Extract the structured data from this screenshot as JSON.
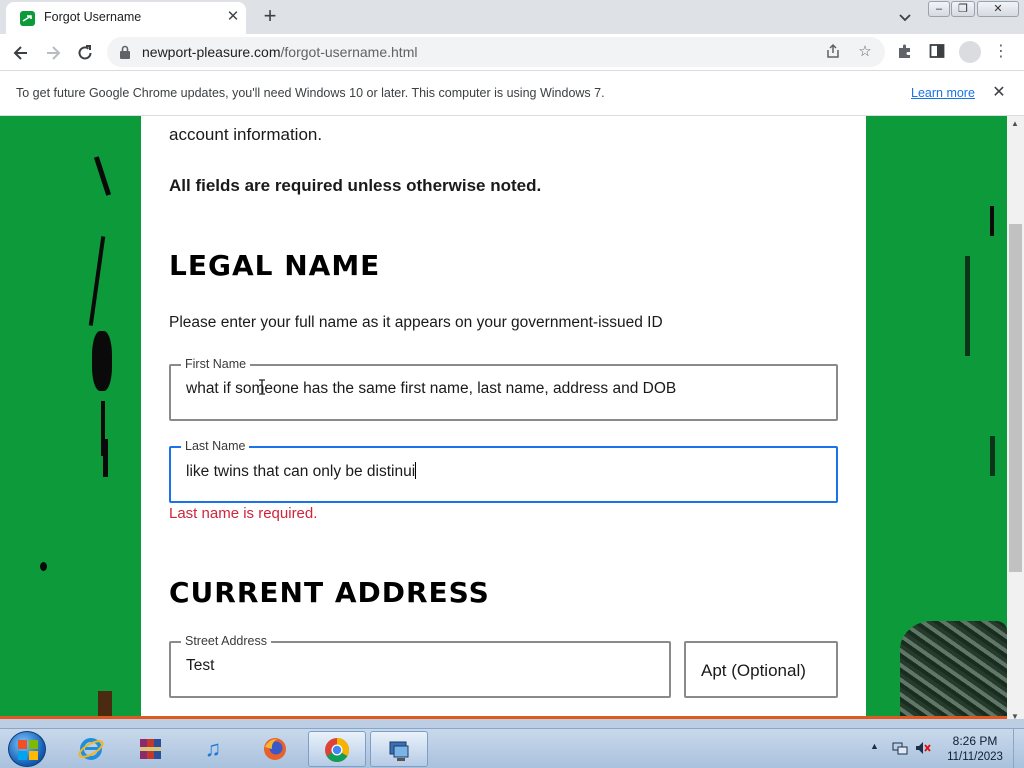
{
  "browser": {
    "tab_title": "Forgot Username",
    "tab_close": "✕",
    "new_tab": "+",
    "url_host": "newport-pleasure.com",
    "url_path": "/forgot-username.html",
    "infobar_text": "To get future Google Chrome updates, you'll need Windows 10 or later. This computer is using Windows 7.",
    "infobar_link": "Learn more",
    "infobar_close": "✕"
  },
  "page": {
    "intro_tail": "account information.",
    "required_note": "All fields are required unless otherwise noted.",
    "legal_name_title": "LEGAL NAME",
    "legal_name_helper": "Please enter your full name as it appears on your government-issued ID",
    "first_name_label": "First Name",
    "first_name_value": "what if someone has the same first name, last name, address and DOB",
    "last_name_label": "Last Name",
    "last_name_value": "like twins that can only be distinui",
    "last_name_error": "Last name is required.",
    "current_address_title": "CURRENT ADDRESS",
    "street_label": "Street Address",
    "street_value": "Test",
    "apt_placeholder": "Apt (Optional)"
  },
  "taskbar": {
    "apps": [
      "internet-explorer",
      "archive-manager",
      "itunes",
      "firefox",
      "chrome",
      "remote-desktop"
    ],
    "active_app": "chrome",
    "time": "8:26 PM",
    "date": "11/11/2023"
  },
  "colors": {
    "page_background": "#0d9a3a",
    "focus_border": "#1a73e8",
    "error": "#d1243a"
  }
}
